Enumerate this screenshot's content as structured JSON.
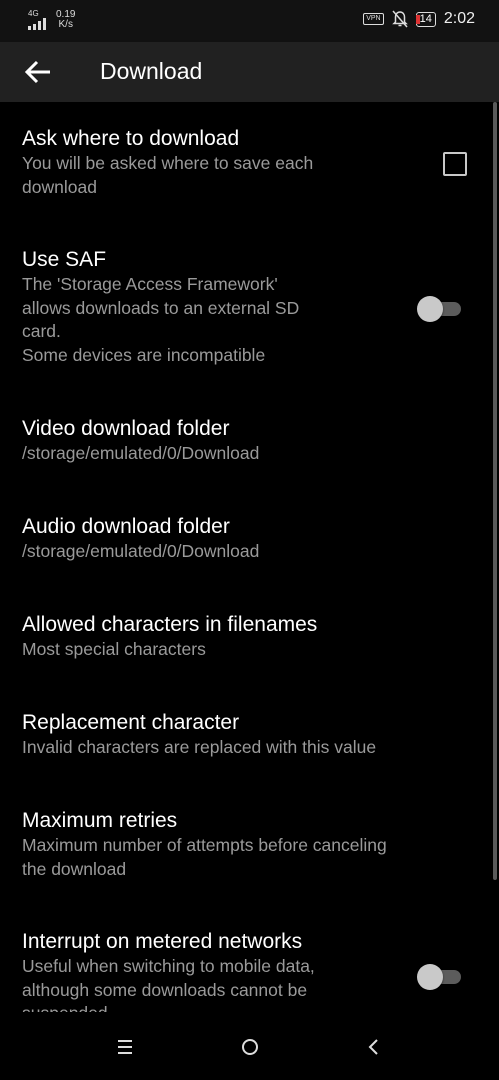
{
  "status_bar": {
    "network": "4G",
    "speed_value": "0.19",
    "speed_unit": "K/s",
    "vpn": "VPN",
    "battery": "14",
    "time": "2:02"
  },
  "app_bar": {
    "title": "Download"
  },
  "preferences": [
    {
      "title": "Ask where to download",
      "summary": "You will be asked where to save each\ndownload",
      "control": "checkbox",
      "checked": false
    },
    {
      "title": "Use SAF",
      "summary": "The 'Storage Access Framework'\nallows downloads to an external SD\ncard.\nSome devices are incompatible",
      "control": "switch",
      "on": false
    },
    {
      "title": "Video download folder",
      "summary": "/storage/emulated/0/Download"
    },
    {
      "title": "Audio download folder",
      "summary": "/storage/emulated/0/Download"
    },
    {
      "title": "Allowed characters in filenames",
      "summary": "Most special characters"
    },
    {
      "title": "Replacement character",
      "summary": "Invalid characters are replaced with this value"
    },
    {
      "title": "Maximum retries",
      "summary": "Maximum number of attempts before canceling\nthe download"
    },
    {
      "title": "Interrupt on metered networks",
      "summary": "Useful when switching to mobile data,\nalthough some downloads cannot be\nsuspended",
      "control": "switch",
      "on": false
    }
  ],
  "colors": {
    "background": "#000000",
    "app_bar": "#212121",
    "summary_text": "#9a9a9a",
    "switch_thumb": "#c9c9c9",
    "switch_track": "#5c5c5c"
  },
  "navigation": {
    "icons": [
      "menu-icon",
      "home-icon",
      "back-icon"
    ]
  }
}
